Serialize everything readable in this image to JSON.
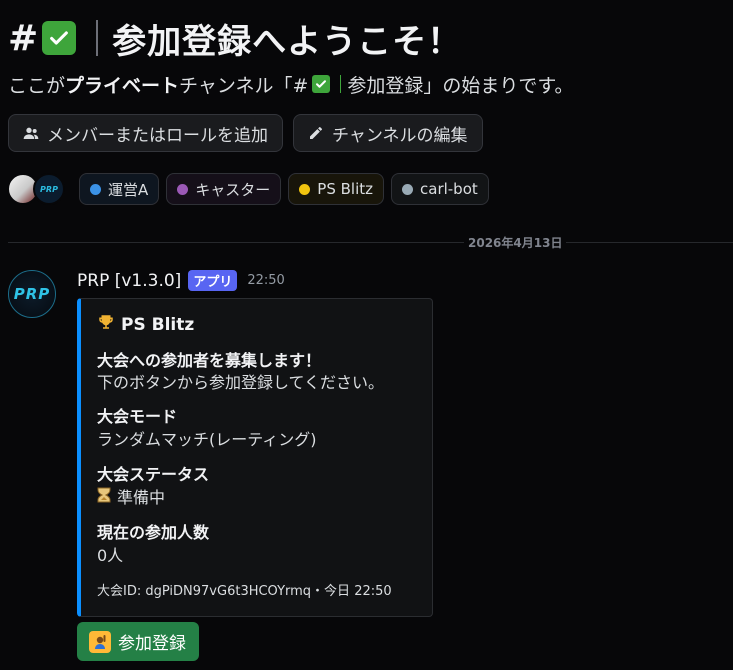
{
  "header": {
    "hash": "#",
    "check_glyph": "✓",
    "title": "参加登録へようこそ！",
    "subtitle_pre": "ここが",
    "subtitle_bold": "プライベート",
    "subtitle_mid": "チャンネル「#",
    "subtitle_channel": "参加登録",
    "subtitle_post": "」の始まりです。"
  },
  "actions": {
    "add_members_label": "メンバーまたはロールを追加",
    "add_members_icon": "people-icon",
    "edit_channel_label": "チャンネルの編集",
    "edit_channel_icon": "pencil-icon"
  },
  "members": {
    "avatar_b_text": "PRP",
    "roles": [
      {
        "label": "運営A",
        "color": "#3b92e6",
        "bg": "#0e1620"
      },
      {
        "label": "キャスター",
        "color": "#9b59b6",
        "bg": "#150f19"
      },
      {
        "label": "PS Blitz",
        "color": "#f1c40f",
        "bg": "#18150a"
      },
      {
        "label": "carl-bot",
        "color": "#99aab5",
        "bg": "#121416"
      }
    ]
  },
  "divider": {
    "date": "2026年4月13日"
  },
  "message": {
    "avatar_logo": "PRP",
    "author": "PRP [v1.3.0]",
    "badge": "アプリ",
    "time": "22:50",
    "embed": {
      "accent": "#0b8fff",
      "title_icon": "trophy-icon",
      "title": "PS Blitz",
      "desc_bold": "大会への参加者を募集します！",
      "desc_line": "下のボタンから参加登録してください。",
      "fields": [
        {
          "name": "大会モード",
          "value": "ランダムマッチ(レーティング)"
        },
        {
          "name": "大会ステータス",
          "value": "準備中"
        },
        {
          "name": "現在の参加人数",
          "value": "0人"
        }
      ],
      "footer": "大会ID: dgPiDN97vG6t3HCOYrmq・今日 22:50"
    },
    "button": {
      "label": "参加登録",
      "icon": "raising-hand-icon",
      "color": "#248046"
    }
  }
}
